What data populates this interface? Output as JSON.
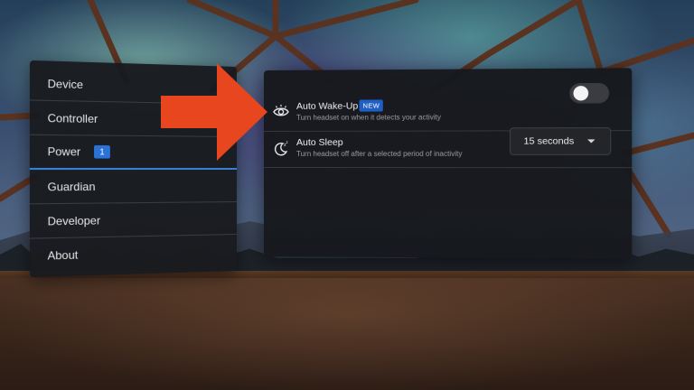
{
  "nav": {
    "items": [
      {
        "label": "Device"
      },
      {
        "label": "Controller"
      },
      {
        "label": "Power",
        "badge": "1",
        "active": true
      },
      {
        "label": "Guardian"
      },
      {
        "label": "Developer"
      },
      {
        "label": "About"
      }
    ]
  },
  "settings": {
    "auto_wakeup": {
      "title": "Auto Wake-Up",
      "badge": "NEW",
      "description": "Turn headset on when it detects your activity",
      "icon": "eye-icon",
      "toggle_on": false
    },
    "auto_sleep": {
      "title": "Auto Sleep",
      "description": "Turn headset off after a selected period of inactivity",
      "icon": "moon-sleep-icon",
      "selected_value": "15 seconds"
    }
  },
  "colors": {
    "accent": "#2a72d6",
    "annotation_arrow": "#e8461e",
    "panel_bg": "#16181c"
  }
}
